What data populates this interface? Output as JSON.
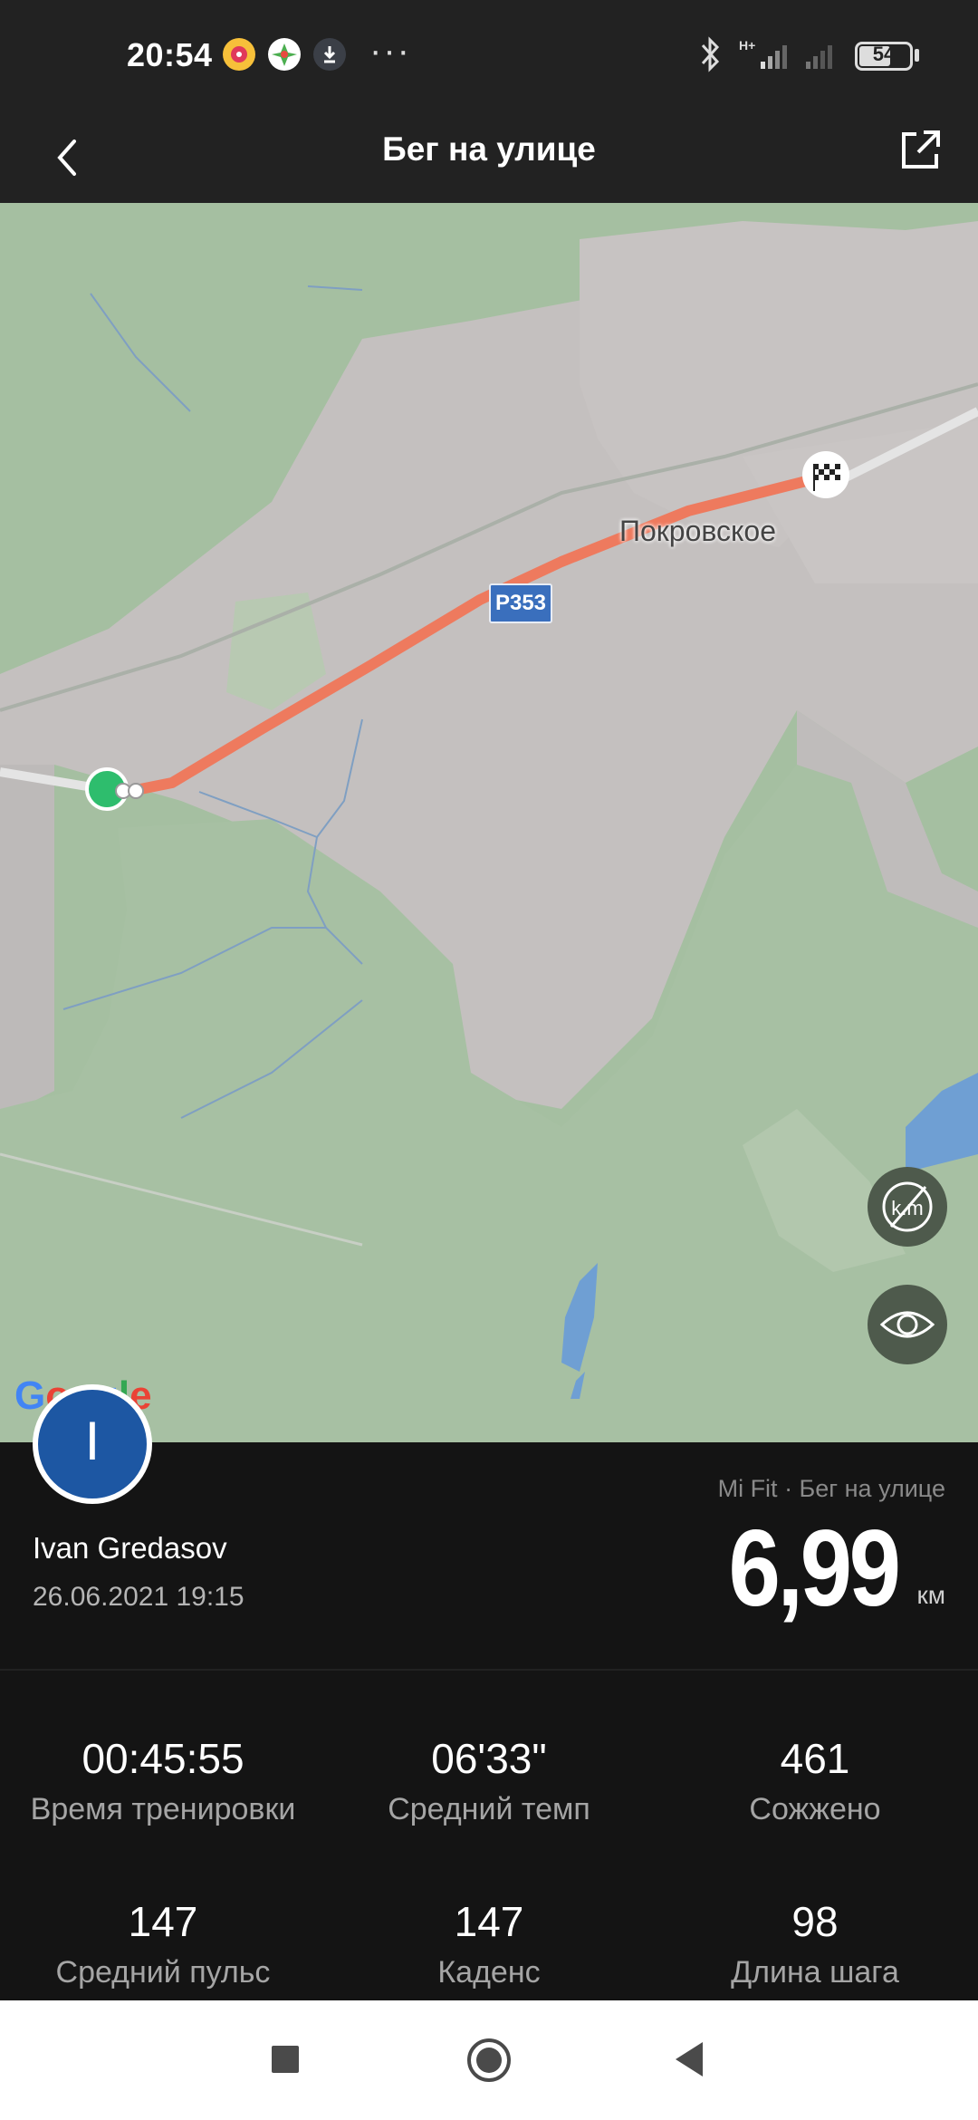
{
  "status_bar": {
    "time": "20:54",
    "dots": "···",
    "network_label": "H+",
    "battery": "54",
    "icons": [
      "music-app-icon",
      "photos-app-icon",
      "download-icon",
      "bluetooth-icon",
      "signal-icon",
      "battery-icon"
    ]
  },
  "header": {
    "title": "Бег на улице",
    "back_icon": "chevron-left-icon",
    "share_icon": "share-icon"
  },
  "map": {
    "town_label": "Покровское",
    "road_label": "Р353",
    "google_letters": [
      "G",
      "o",
      "o",
      "g",
      "l",
      "e"
    ],
    "colors": {
      "land": "#a5bfa1",
      "urban": "#c4c0bf",
      "route": "#ee7a5e",
      "start": "#2ebd6d",
      "water": "#6f9fd3"
    }
  },
  "workout": {
    "user_initial": "I",
    "user_name": "Ivan Gredasov",
    "date": "26.06.2021 19:15",
    "source": "Mi Fit · Бег на улице",
    "distance": "6,99",
    "distance_unit": "км"
  },
  "stats": [
    {
      "value": "00:45:55",
      "label": "Время тренировки"
    },
    {
      "value": "06'33\"",
      "label": "Средний темп"
    },
    {
      "value": "461",
      "label": "Сожжено"
    },
    {
      "value": "147",
      "label": "Средний пульс"
    },
    {
      "value": "147",
      "label": "Каденс"
    },
    {
      "value": "98",
      "label": "Длина шага"
    }
  ]
}
